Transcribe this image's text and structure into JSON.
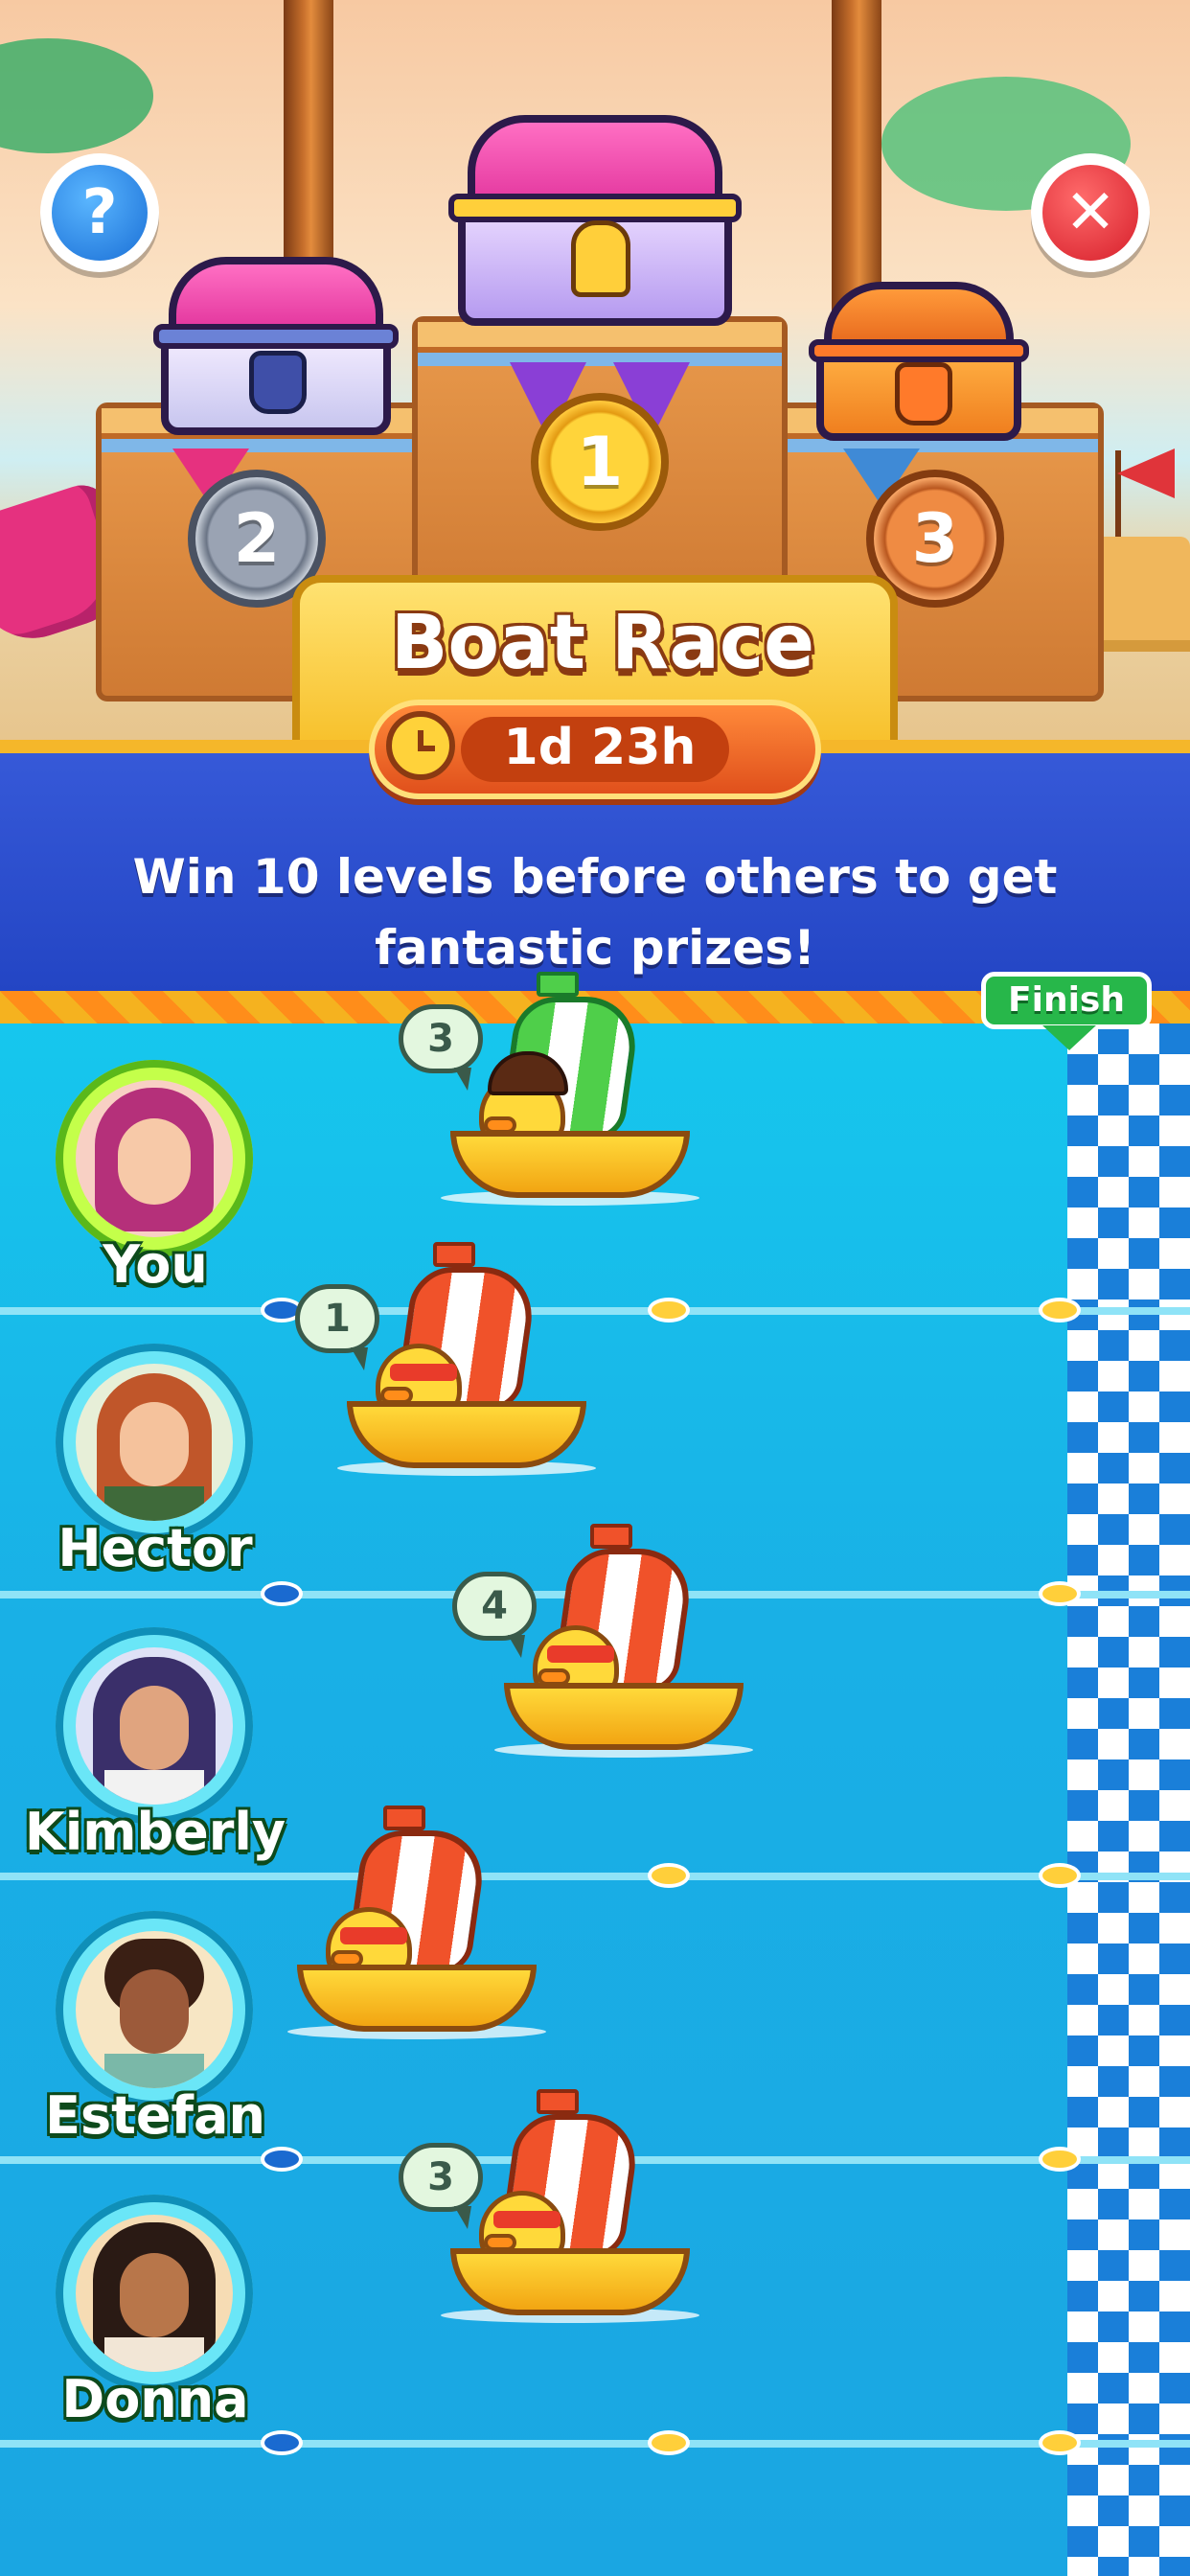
{
  "header": {
    "title": "Boat Race",
    "timer": "1d 23h",
    "help_label": "?",
    "close_label": "✕"
  },
  "podium": {
    "first": "1",
    "second": "2",
    "third": "3"
  },
  "subtitle": "Win 10 levels before others to get fantastic prizes!",
  "finish_label": "Finish",
  "players": [
    {
      "name": "You",
      "score": "3",
      "is_you": true
    },
    {
      "name": "Hector",
      "score": "1",
      "is_you": false
    },
    {
      "name": "Kimberly",
      "score": "4",
      "is_you": false
    },
    {
      "name": "Estefan",
      "score": "",
      "is_you": false
    },
    {
      "name": "Donna",
      "score": "3",
      "is_you": false
    }
  ],
  "colors": {
    "banner": "#2a4fd0",
    "water": "#19b6e6",
    "finish_green": "#27b74a",
    "timer_orange": "#e0501c"
  },
  "icons": [
    "help-icon",
    "close-icon",
    "timer-icon",
    "gold-chest-icon",
    "silver-chest-icon",
    "bronze-chest-icon"
  ]
}
